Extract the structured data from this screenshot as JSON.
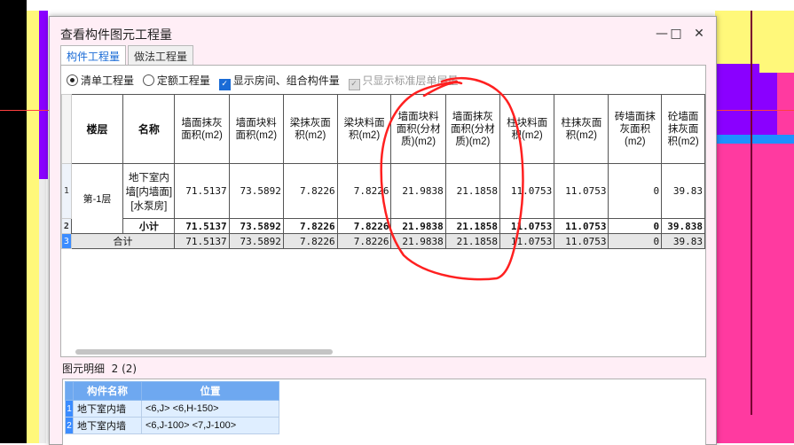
{
  "dialog": {
    "title": "查看构件图元工程量",
    "minimize": "—",
    "maximize": "□",
    "close": "✕",
    "tabs": [
      {
        "label": "构件工程量",
        "active": true
      },
      {
        "label": "做法工程量",
        "active": false
      }
    ]
  },
  "options": {
    "radio1": "清单工程量",
    "radio2": "定额工程量",
    "check1": "显示房间、组合构件量",
    "check2": "只显示标准层单层量"
  },
  "table": {
    "headers": [
      "楼层",
      "名称",
      "墙面抹灰面积(m2)",
      "墙面块料面积(m2)",
      "梁抹灰面积(m2)",
      "梁块料面积(m2)",
      "墙面块料面积(分材质)(m2)",
      "墙面抹灰面积(分材质)(m2)",
      "柱块料面积(m2)",
      "柱抹灰面积(m2)",
      "砖墙面抹灰面积(m2)",
      "砼墙面抹灰面积(m2)"
    ],
    "rows": [
      {
        "rn": "1",
        "floor": "第-1层",
        "name": "地下室内墙[内墙面][水泵房]",
        "vals": [
          "71.5137",
          "73.5892",
          "7.8226",
          "7.8226",
          "21.9838",
          "21.1858",
          "11.0753",
          "11.0753",
          "0",
          "39.83"
        ]
      },
      {
        "rn": "2",
        "floor": "",
        "name": "小计",
        "vals": [
          "71.5137",
          "73.5892",
          "7.8226",
          "7.8226",
          "21.9838",
          "21.1858",
          "11.0753",
          "11.0753",
          "0",
          "39.838"
        ]
      },
      {
        "rn": "3",
        "floor": "合计",
        "name": "",
        "vals": [
          "71.5137",
          "73.5892",
          "7.8226",
          "7.8226",
          "21.9838",
          "21.1858",
          "11.0753",
          "11.0753",
          "0",
          "39.83"
        ]
      }
    ]
  },
  "detail": {
    "label": "图元明细",
    "count": "2 (2)",
    "headers": [
      "构件名称",
      "位置"
    ],
    "rows": [
      {
        "rn": "1",
        "name": "地下室内墙",
        "pos": "<6,J> <6,H-150>"
      },
      {
        "rn": "2",
        "name": "地下室内墙",
        "pos": "<6,J-100> <7,J-100>"
      }
    ]
  },
  "colors": {
    "accent": "#1a6bd6",
    "annotation": "#ff2020",
    "dialog_bg": "#ffeef6"
  }
}
